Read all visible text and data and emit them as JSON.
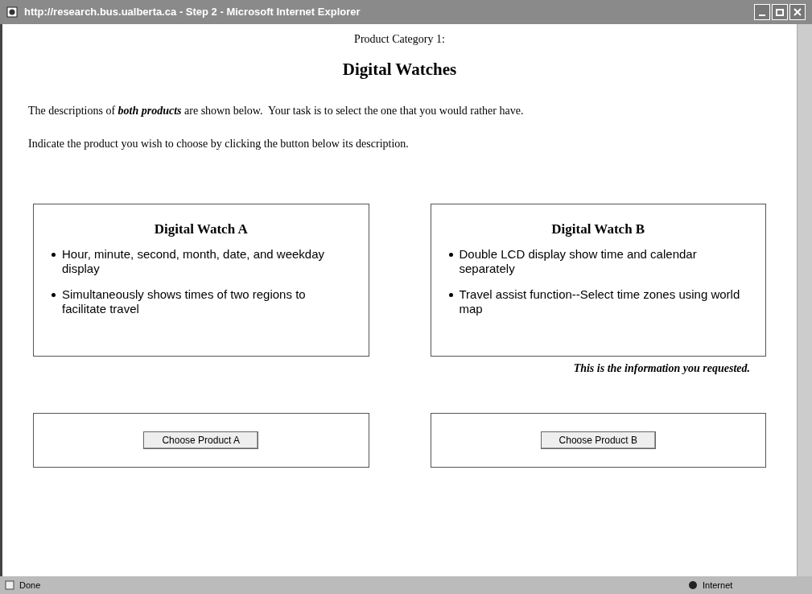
{
  "window": {
    "title": "http://research.bus.ualberta.ca - Step 2 - Microsoft Internet Explorer"
  },
  "page": {
    "category": "Product Category 1:",
    "heading": "Digital Watches",
    "intro": {
      "before": "The descriptions of ",
      "emphasis": "both products",
      "after": " are shown below.  Your task is to select the one that you would rather have."
    },
    "instruction": "Indicate the product you wish to choose by clicking the button below its description."
  },
  "products": [
    {
      "name": "Digital Watch A",
      "features": [
        "Hour, minute, second, month, date, and weekday display",
        "Simultaneously shows times of two regions to facilitate travel"
      ],
      "button": "Choose Product A"
    },
    {
      "name": "Digital Watch B",
      "features": [
        "Double LCD display show time and calendar separately",
        "Travel assist function--Select time zones using world map"
      ],
      "note": "This is the information you requested.",
      "button": "Choose Product B"
    }
  ],
  "status_bar": {
    "status": "Done",
    "zone": "Internet"
  }
}
